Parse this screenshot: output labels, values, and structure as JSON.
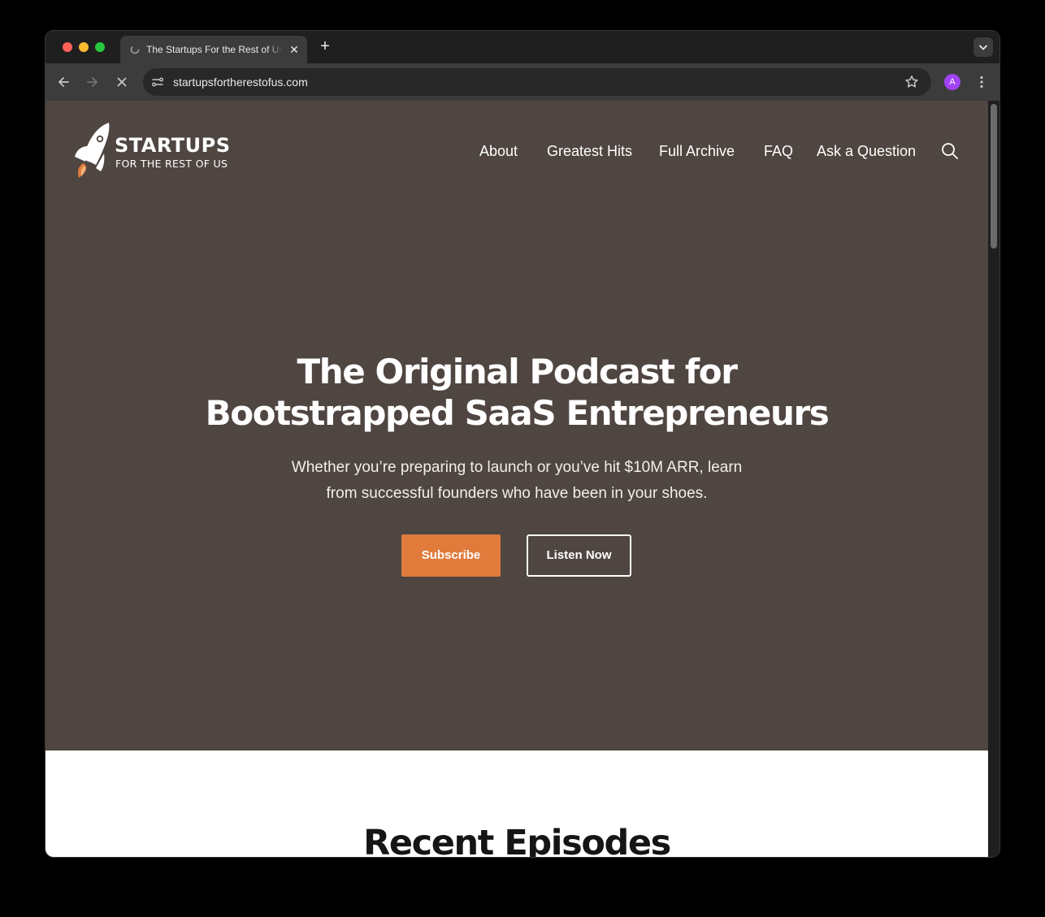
{
  "browser": {
    "tab_title": "The Startups For the Rest of Us",
    "tab_close": "✕",
    "new_tab": "+",
    "url": "startupsfortherestofus.com",
    "profile_initial": "A"
  },
  "site": {
    "logo_word": "STARTUPS",
    "logo_sub": "FOR THE REST OF US",
    "nav": [
      "About",
      "Greatest Hits",
      "Full Archive",
      "FAQ",
      "Ask a Question"
    ],
    "hero_title_line1": "The Original Podcast for",
    "hero_title_line2": "Bootstrapped SaaS Entrepreneurs",
    "hero_sub_line1": "Whether you’re preparing to launch or you’ve hit $10M ARR, learn",
    "hero_sub_line2": "from successful founders who have been in your shoes.",
    "subscribe_label": "Subscribe",
    "listen_label": "Listen Now",
    "recent_title": "Recent Episodes"
  },
  "colors": {
    "hero_bg": "#4f4541",
    "accent": "#e07b3c",
    "page_bg": "#ffffff"
  },
  "icons": [
    "back-arrow-icon",
    "forward-arrow-icon",
    "stop-loading-icon",
    "site-settings-icon",
    "bookmark-star-icon",
    "more-menu-icon",
    "search-icon",
    "rocket-logo-icon",
    "tab-search-chevron-icon"
  ]
}
